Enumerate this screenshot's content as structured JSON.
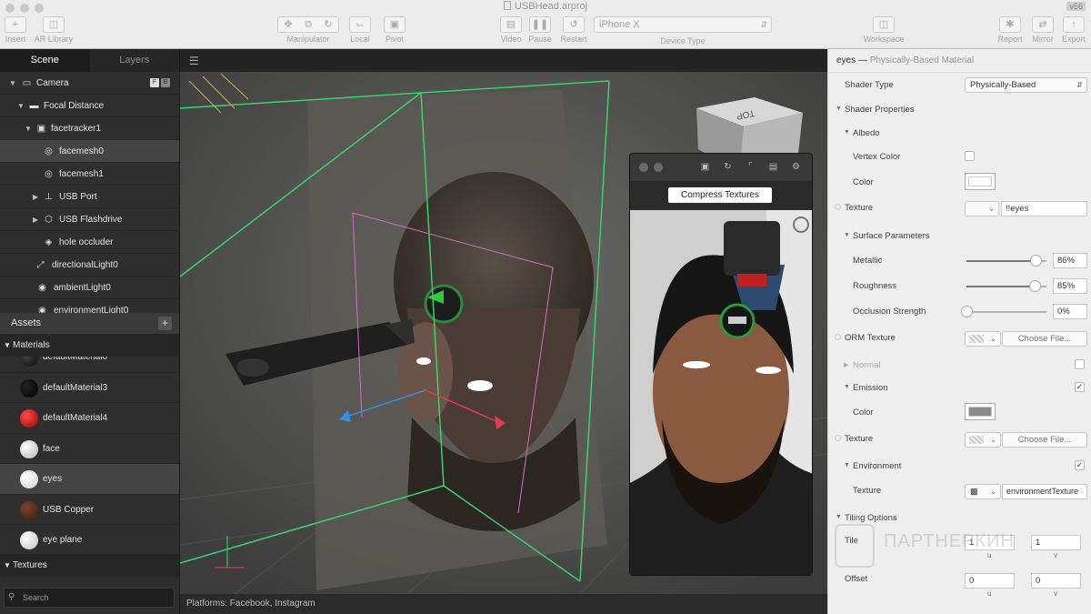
{
  "window": {
    "title": "USBHead.arproj",
    "version": "v56"
  },
  "toolbar": {
    "insert": "Insert",
    "ar_library": "AR Library",
    "manipulator": "Manipulator",
    "local": "Local",
    "pivot": "Pivot",
    "video": "Video",
    "pause": "Pause",
    "restart": "Restart",
    "device_value": "iPhone X",
    "device_label": "Device Type",
    "workspace": "Workspace",
    "report": "Report",
    "mirror": "Mirror",
    "export": "Export"
  },
  "left": {
    "tabs": {
      "scene": "Scene",
      "layers": "Layers"
    },
    "camera_badges": [
      "F",
      "B"
    ],
    "tree": [
      {
        "label": "Camera",
        "icon": "camera-icon"
      },
      {
        "label": "Focal Distance",
        "icon": "focal-distance-icon"
      },
      {
        "label": "facetracker1",
        "icon": "facetracker-icon"
      },
      {
        "label": "facemesh0",
        "icon": "mesh-icon"
      },
      {
        "label": "facemesh1",
        "icon": "mesh-icon"
      },
      {
        "label": "USB Port",
        "icon": "usb-icon"
      },
      {
        "label": "USB Flashdrive",
        "icon": "cube-icon"
      },
      {
        "label": "hole occluder",
        "icon": "occluder-icon"
      },
      {
        "label": "directionalLight0",
        "icon": "directional-light-icon"
      },
      {
        "label": "ambientLight0",
        "icon": "ambient-light-icon"
      },
      {
        "label": "environmentLight0",
        "icon": "environment-light-icon"
      }
    ],
    "assets": "Assets",
    "materials_label": "Materials",
    "materials": [
      {
        "label": "defaultMaterial0",
        "color": "#1a1a1a"
      },
      {
        "label": "defaultMaterial3",
        "color": "#050505"
      },
      {
        "label": "defaultMaterial4",
        "color": "#d40000"
      },
      {
        "label": "face",
        "color": "#eeeeee"
      },
      {
        "label": "eyes",
        "color": "#ffffff"
      },
      {
        "label": "USB Copper",
        "color": "#5a3220"
      },
      {
        "label": "eye plane",
        "color": "#f2f2f2"
      }
    ],
    "textures_label": "Textures",
    "search_placeholder": "Search"
  },
  "viewport": {
    "status": "Platforms: Facebook, Instagram",
    "nav_cube": "TOP",
    "preview_button": "Compress Textures"
  },
  "right": {
    "title": "eyes",
    "subtitle": "Physically-Based Material",
    "shader_type_label": "Shader Type",
    "shader_type_value": "Physically-Based",
    "shader_properties": "Shader Properties",
    "albedo": "Albedo",
    "vertex_color": "Vertex Color",
    "color": "Color",
    "texture": "Texture",
    "albedo_texture_value": "!!eyes",
    "surface_parameters": "Surface Parameters",
    "metallic": "Metallic",
    "metallic_value": "86%",
    "metallic_level": 0.86,
    "roughness": "Roughness",
    "roughness_value": "85%",
    "roughness_level": 0.85,
    "occlusion": "Occlusion Strength",
    "occlusion_value": "0%",
    "occlusion_level": 0,
    "orm_texture": "ORM Texture",
    "choose_file": "Choose File...",
    "normal": "Normal",
    "emission": "Emission",
    "emission_color": "#8a8a8a",
    "environment": "Environment",
    "environment_texture": "environmentTexture",
    "tiling_options": "Tiling Options",
    "tile": "Tile",
    "tile_u": "1",
    "tile_v": "1",
    "offset": "Offset",
    "offset_u": "0",
    "offset_v": "0",
    "u": "u",
    "v": "v"
  },
  "watermark": "ПАРТНЕРКИН"
}
